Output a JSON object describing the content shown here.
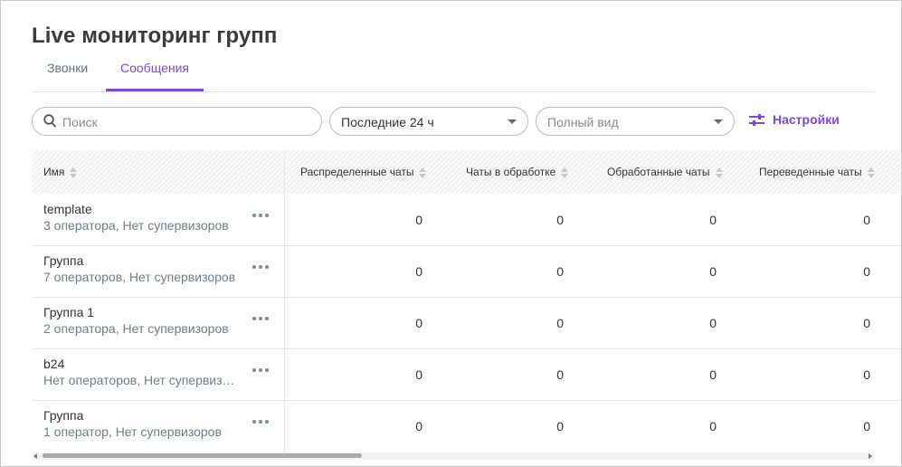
{
  "page": {
    "title": "Live мониторинг групп"
  },
  "tabs": [
    {
      "label": "Звонки",
      "active": false
    },
    {
      "label": "Сообщения",
      "active": true
    }
  ],
  "filters": {
    "search_placeholder": "Поиск",
    "period": "Последние 24 ч",
    "view_placeholder": "Полный вид",
    "settings_label": "Настройки"
  },
  "table": {
    "columns": [
      "Имя",
      "Распределенные чаты",
      "Чаты в обработке",
      "Обработанные чаты",
      "Переведенные чаты"
    ],
    "rows": [
      {
        "name": "template",
        "sub": "3 оператора, Нет супервизоров",
        "values": [
          "0",
          "0",
          "0",
          "0"
        ]
      },
      {
        "name": "Группа",
        "sub": "7 операторов, Нет супервизоров",
        "values": [
          "0",
          "0",
          "0",
          "0"
        ]
      },
      {
        "name": "Группа 1",
        "sub": "2 оператора, Нет супервизоров",
        "values": [
          "0",
          "0",
          "0",
          "0"
        ]
      },
      {
        "name": "b24",
        "sub": "Нет операторов, Нет супервизоров",
        "values": [
          "0",
          "0",
          "0",
          "0"
        ]
      },
      {
        "name": "Группа",
        "sub": "1 оператор, Нет супервизоров",
        "values": [
          "0",
          "0",
          "0",
          "0"
        ]
      }
    ]
  },
  "colors": {
    "accent": "#7b4bd6",
    "subtext": "#6b7f8e"
  }
}
